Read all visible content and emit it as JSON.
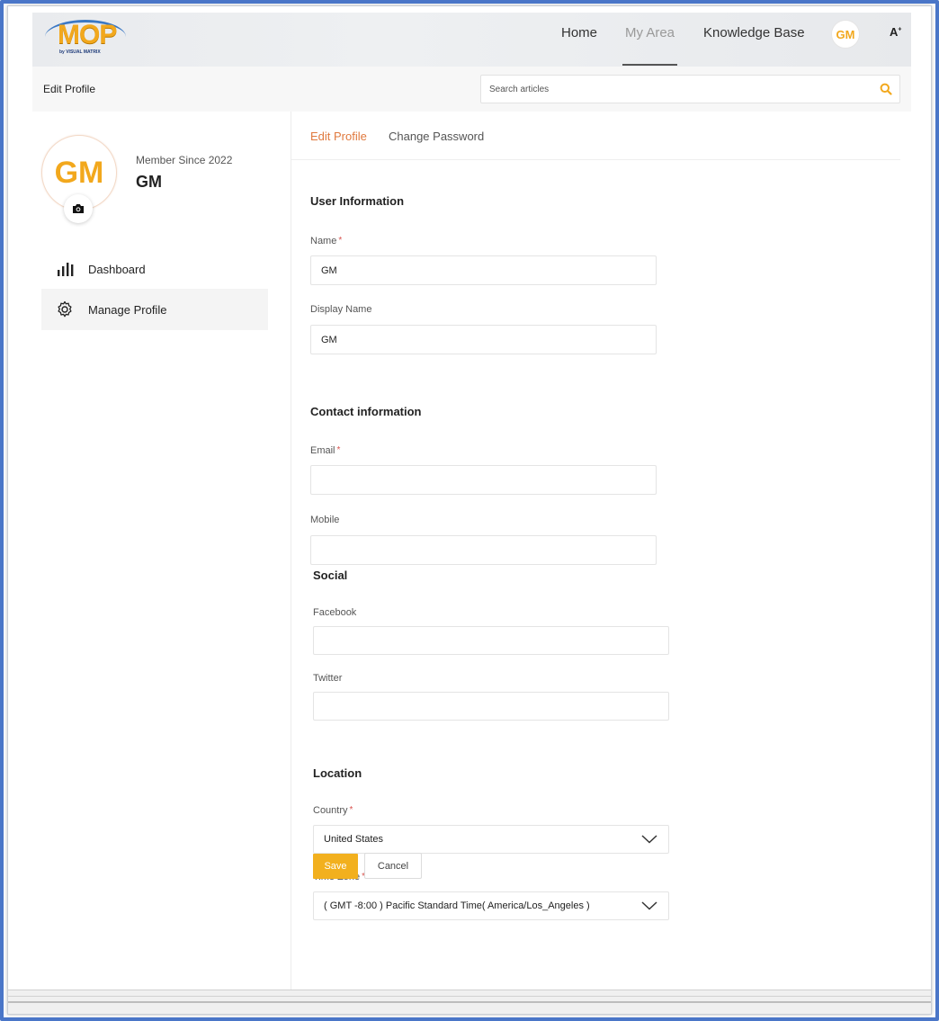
{
  "brand": {
    "logo_text": "MOP",
    "logo_subtext": "by VISUAL MATRIX",
    "accent_color": "#f2a81d",
    "link_color": "#e0793e"
  },
  "nav": {
    "items": [
      {
        "label": "Home"
      },
      {
        "label": "My Area"
      },
      {
        "label": "Knowledge Base"
      }
    ],
    "avatar_initials": "GM",
    "font_size_icon": "A"
  },
  "subheader": {
    "title": "Edit Profile",
    "search_placeholder": "Search articles"
  },
  "profile": {
    "initials": "GM",
    "member_since": "Member Since 2022",
    "name": "GM"
  },
  "sidebar": {
    "items": [
      {
        "label": "Dashboard",
        "icon": "bar-chart-icon"
      },
      {
        "label": "Manage Profile",
        "icon": "gear-icon"
      }
    ]
  },
  "tabs": {
    "edit_profile": "Edit Profile",
    "change_password": "Change Password"
  },
  "user_info": {
    "title": "User Information",
    "name_label": "Name",
    "name_value": "GM",
    "display_name_label": "Display Name",
    "display_name_value": "GM"
  },
  "contact": {
    "title": "Contact information",
    "email_label": "Email",
    "email_value": "",
    "mobile_label": "Mobile",
    "mobile_value": ""
  },
  "social": {
    "title": "Social",
    "facebook_label": "Facebook",
    "facebook_value": "",
    "twitter_label": "Twitter",
    "twitter_value": ""
  },
  "location": {
    "title": "Location",
    "country_label": "Country",
    "country_value": "United States",
    "timezone_label": "Time Zone",
    "timezone_value": "( GMT -8:00 ) Pacific Standard Time( America/Los_Angeles )"
  },
  "required_marker": "*",
  "actions": {
    "save_label": "Save",
    "cancel_label": "Cancel"
  }
}
